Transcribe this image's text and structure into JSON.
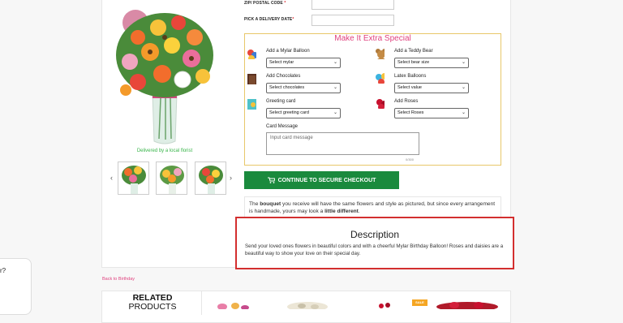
{
  "form": {
    "zip_label": "ZIP/ POSTAL CODE",
    "zip_required": "*",
    "date_label": "PICK A DELIVERY DATE",
    "date_required": "*"
  },
  "gallery": {
    "local_text": "Delivered by a local florist",
    "prev_arrow": "‹",
    "next_arrow": "›"
  },
  "extras": {
    "title": "Make It Extra Special",
    "items": [
      {
        "label": "Add a Mylar Balloon",
        "selected": "Select mylar",
        "icon": "mylar-balloon-icon"
      },
      {
        "label": "Add a Teddy Bear",
        "selected": "Select bear size",
        "icon": "teddy-bear-icon"
      },
      {
        "label": "Add Chocolates",
        "selected": "Select chocolates",
        "icon": "chocolates-icon"
      },
      {
        "label": "Latex Balloons",
        "selected": "Select value",
        "icon": "latex-balloons-icon"
      },
      {
        "label": "Greeting card",
        "selected": "Select greeting card",
        "icon": "greeting-card-icon"
      },
      {
        "label": "Add Roses",
        "selected": "Select Roses",
        "icon": "roses-icon"
      }
    ],
    "card_message_label": "Card Message",
    "card_message_placeholder": "Input card message",
    "card_counter": "0/300"
  },
  "checkout": {
    "label": "CONTINUE TO SECURE CHECKOUT",
    "icon": "cart-icon"
  },
  "note": {
    "prefix": "The ",
    "bold1": "bouquet",
    "middle": " you receive will have the same flowers and style as pictured, but since every arrangement is handmade, yours may look a ",
    "bold2": "little different",
    "suffix": "."
  },
  "description": {
    "title": "Description",
    "text": "Send your loved ones flowers in beautiful colors and with a cheerful Mylar Birthday Balloon! Roses and daisies are a beautiful way to show your love on their special day."
  },
  "back_link": "Back to Birthday",
  "related": {
    "line1": "RELATED",
    "line2": "PRODUCTS",
    "sale_badge": "SALE"
  },
  "chat": {
    "text": "r?"
  },
  "colors": {
    "accent_pink": "#e0427f",
    "checkout_green": "#1a8a3d",
    "highlight_red": "#d32f2f",
    "extras_border": "#e8c76a"
  }
}
